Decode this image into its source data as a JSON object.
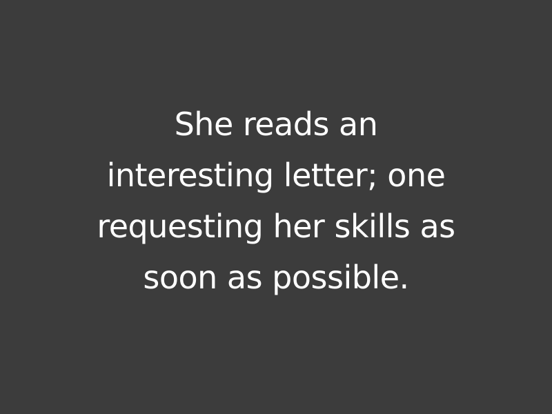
{
  "background_color": "#3c3c3c",
  "text_color": "#ffffff",
  "caption": {
    "lines": [
      "She reads an",
      "interesting letter; one",
      "requesting her skills as",
      "soon as possible."
    ]
  }
}
